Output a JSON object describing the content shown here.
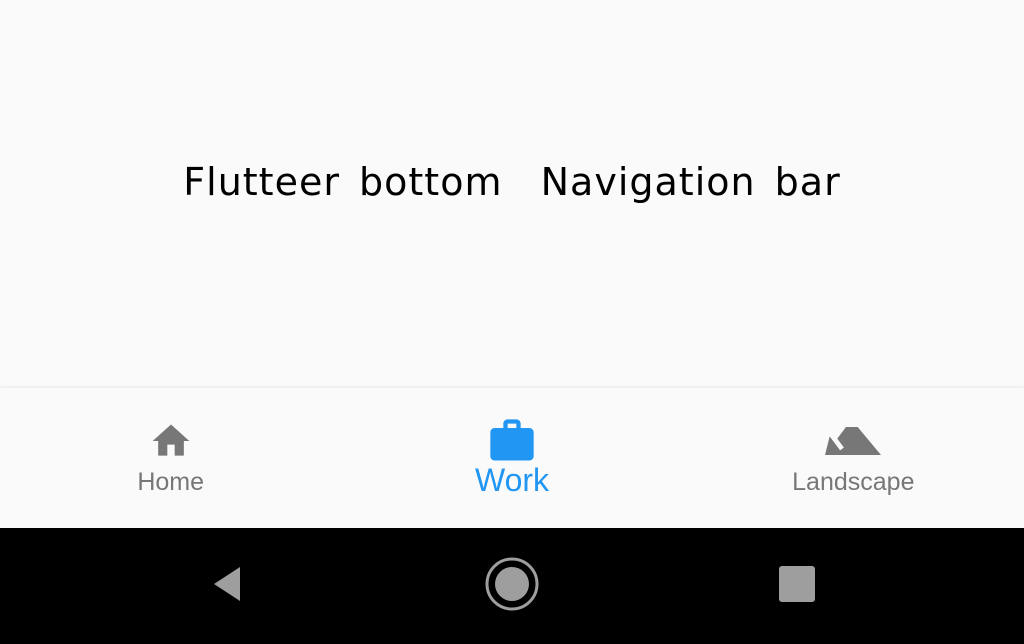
{
  "page": {
    "title": "Flutteer bottom  Navigation bar"
  },
  "bottom_nav": {
    "active_index": 1,
    "active_color": "#2196f3",
    "inactive_color": "#777777",
    "items": [
      {
        "label": "Home",
        "icon": "home-icon"
      },
      {
        "label": "Work",
        "icon": "briefcase-icon"
      },
      {
        "label": "Landscape",
        "icon": "landscape-icon"
      }
    ]
  },
  "system_nav": {
    "buttons": [
      {
        "icon": "back-triangle-icon"
      },
      {
        "icon": "home-circle-icon"
      },
      {
        "icon": "recents-square-icon"
      }
    ],
    "color": "#9e9e9e"
  }
}
